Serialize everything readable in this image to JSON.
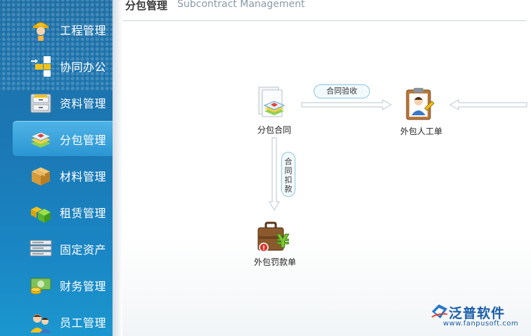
{
  "sidebar": {
    "items": [
      {
        "label": "工程管理",
        "icon": "worker-icon"
      },
      {
        "label": "协同办公",
        "icon": "blocks-icon"
      },
      {
        "label": "资料管理",
        "icon": "file-cabinet-icon"
      },
      {
        "label": "分包管理",
        "icon": "layers-icon",
        "active": true
      },
      {
        "label": "材料管理",
        "icon": "box-icon"
      },
      {
        "label": "租赁管理",
        "icon": "cubes-icon"
      },
      {
        "label": "固定资产",
        "icon": "server-rack-icon"
      },
      {
        "label": "财务管理",
        "icon": "money-icon"
      },
      {
        "label": "员工管理",
        "icon": "users-icon"
      }
    ]
  },
  "header": {
    "title_zh": "分包管理",
    "title_en": "Subcontract Management"
  },
  "flow": {
    "nodes": {
      "contract": "分包合同",
      "labor": "外包人工单",
      "penalty": "外包罚款单"
    },
    "edges": {
      "accept": "合同验收",
      "deduct": "合同扣款"
    }
  },
  "brand": {
    "name": "泛普软件",
    "url": "www.fanpusoft.com"
  },
  "colors": {
    "sidebar_bg": "#1b77b3",
    "active_item": "#2b96d3",
    "brand": "#1a5ea8"
  }
}
